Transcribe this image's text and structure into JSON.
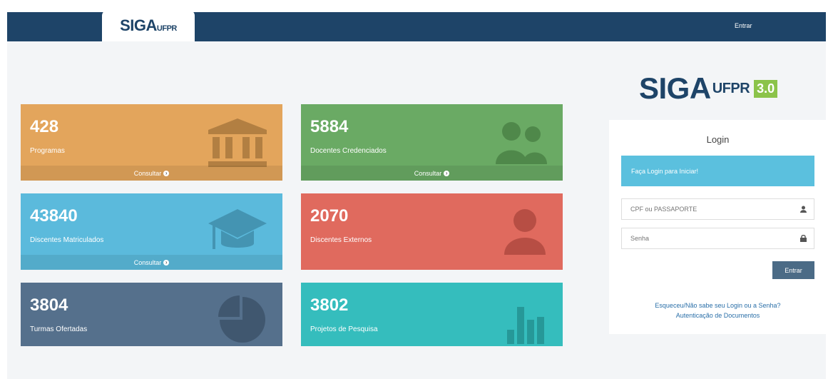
{
  "navbar": {
    "logo": {
      "siga": "SIGA",
      "ufpr": "UFPR"
    },
    "login_link": "Entrar"
  },
  "tiles": [
    {
      "number": "428",
      "label": "Programas",
      "footer": "Consultar",
      "color": "#e3a55c",
      "icon": "institution-icon"
    },
    {
      "number": "5884",
      "label": "Docentes Credenciados",
      "footer": "Consultar",
      "color": "#6aaa64",
      "icon": "users-icon"
    },
    {
      "number": "43840",
      "label": "Discentes Matriculados",
      "footer": "Consultar",
      "color": "#5bbadc",
      "icon": "graduation-cap-icon"
    },
    {
      "number": "2070",
      "label": "Discentes Externos",
      "color": "#e06a5e",
      "icon": "user-icon"
    },
    {
      "number": "3804",
      "label": "Turmas Ofertadas",
      "color": "#55708c",
      "icon": "pie-chart-icon"
    },
    {
      "number": "3802",
      "label": "Projetos de Pesquisa",
      "color": "#35bdbd",
      "icon": "bar-chart-icon"
    }
  ],
  "login": {
    "logo": {
      "siga": "SIGA",
      "ufpr": "UFPR",
      "version": "3.0"
    },
    "title": "Login",
    "info": "Faça Login para Iniciar!",
    "cpf_placeholder": "CPF ou PASSAPORTE",
    "password_placeholder": "Senha",
    "submit": "Entrar",
    "forgot_link": "Esqueceu/Não sabe seu Login ou a Senha?",
    "auth_link": "Autenticação de Documentos"
  },
  "colors": {
    "navbar": "#1e4468",
    "page_bg": "#f3f5f7",
    "version_badge": "#8bc34a",
    "info_box": "#5bc0de",
    "button": "#4b6b86",
    "link": "#2a6fa8"
  }
}
